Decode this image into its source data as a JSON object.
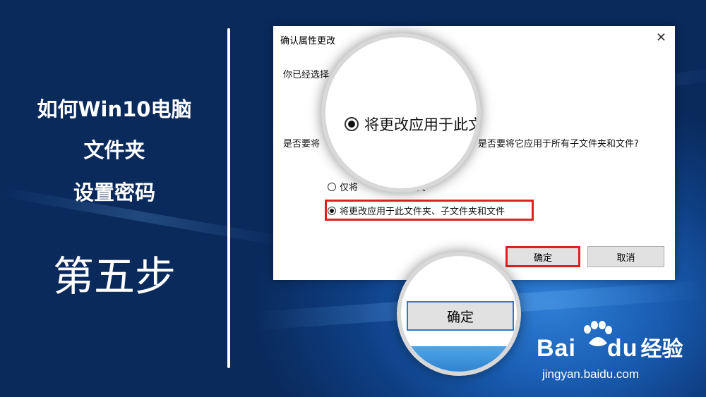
{
  "slide": {
    "title_lines": [
      "如何Win10电脑",
      "文件夹",
      "设置密码"
    ],
    "step_label": "第五步"
  },
  "dialog": {
    "title": "确认属性更改",
    "close_glyph": "✕",
    "line1": "你已经选择",
    "line2_left": "是否要将",
    "line2_right": "是否要将它应用于所有子文件夹和文件?",
    "option1_label": "仅将",
    "option1_tail": "件夹",
    "option2_label": "将更改应用于此文件夹、子文件夹和文件",
    "ok_label": "确定",
    "cancel_label": "取消"
  },
  "magnifier_top": {
    "label": "将更改应用于此文"
  },
  "magnifier_bottom": {
    "button_label": "确定"
  },
  "watermark": {
    "brand": "Bai",
    "brand_tail": "du",
    "brand_cn": "经验",
    "url": "jingyan.baidu.com"
  },
  "colors": {
    "highlight": "#e02020",
    "focus": "#2b7bd6"
  }
}
